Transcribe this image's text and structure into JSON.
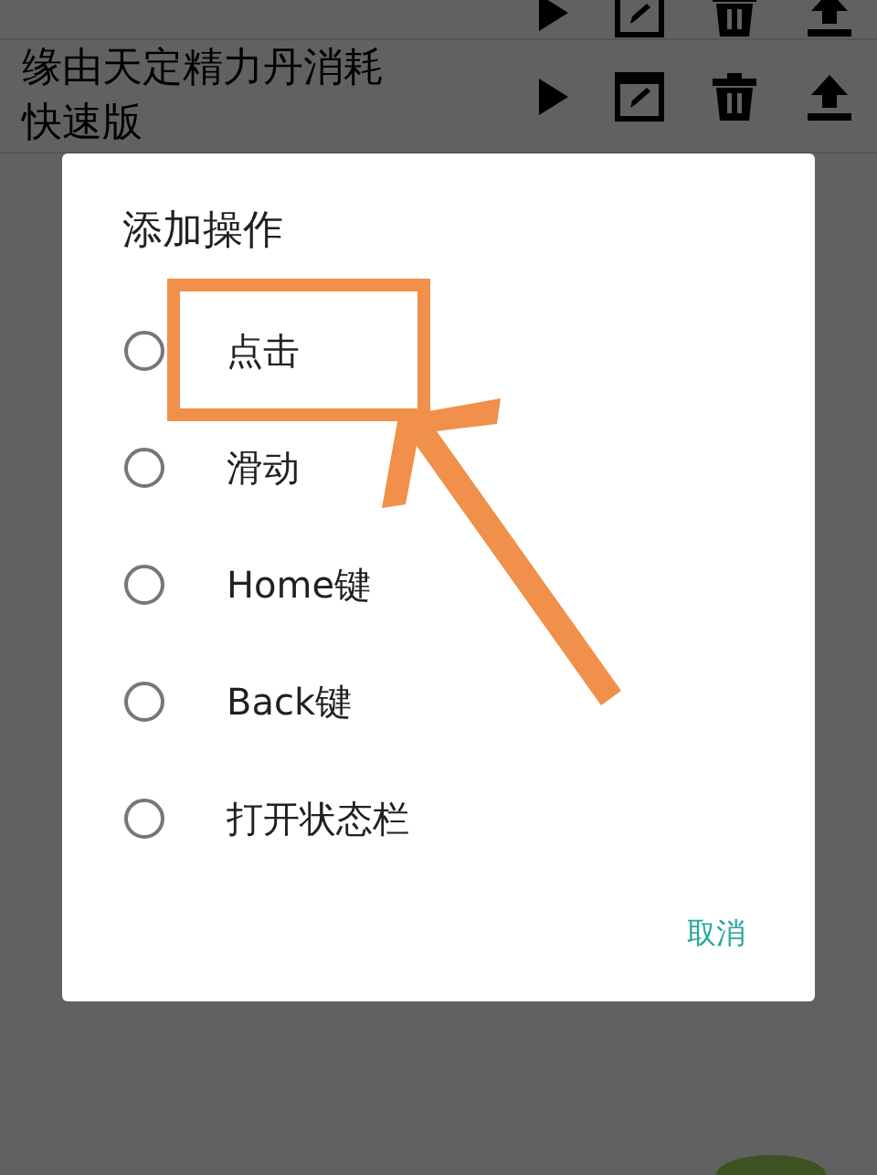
{
  "list": {
    "rows": [
      {
        "cut_off": true
      },
      {
        "cut_off": false,
        "title": "缘由天定精力丹消耗快速版"
      }
    ]
  },
  "dialog": {
    "title": "添加操作",
    "options": [
      {
        "label": "点击",
        "selected": false
      },
      {
        "label": "滑动",
        "selected": false
      },
      {
        "label": "Home键",
        "selected": false
      },
      {
        "label": "Back键",
        "selected": false
      },
      {
        "label": "打开状态栏",
        "selected": false
      }
    ],
    "buttons": [
      "取消"
    ]
  }
}
